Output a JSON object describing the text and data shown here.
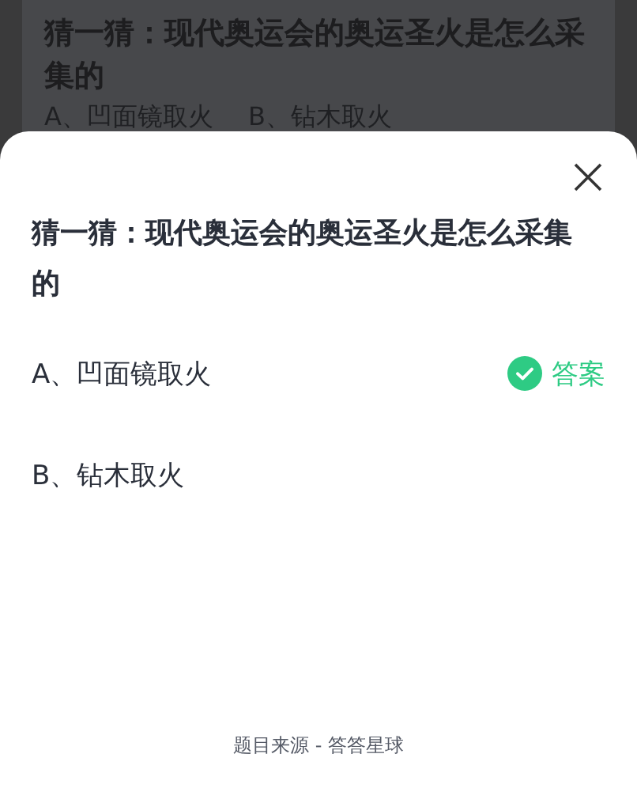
{
  "background_page": {
    "question": "猜一猜：现代奥运会的奥运圣火是怎么采集的",
    "options": [
      "A、凹面镜取火",
      "B、钻木取火"
    ]
  },
  "sheet": {
    "question": "猜一猜：现代奥运会的奥运圣火是怎么采集的",
    "options": [
      {
        "label": "A、凹面镜取火",
        "correct": true
      },
      {
        "label": "B、钻木取火",
        "correct": false
      }
    ],
    "answer_label": "答案",
    "footer": "题目来源 - 答答星球"
  }
}
